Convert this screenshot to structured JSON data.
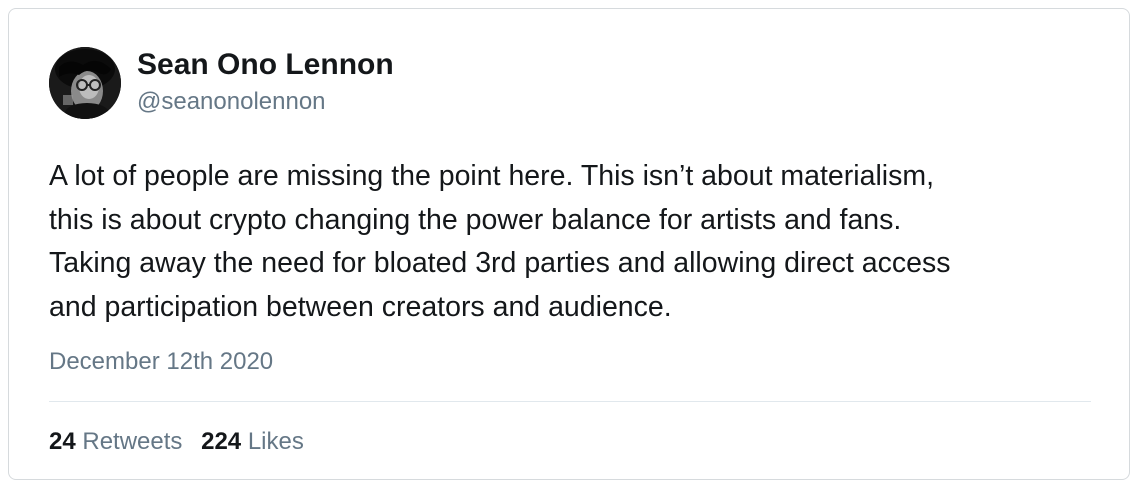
{
  "tweet": {
    "author": {
      "name": "Sean Ono Lennon",
      "handle": "@seanonolennon",
      "avatar": "profile-photo"
    },
    "text_lines": [
      "A lot of people are missing the point here. This isn’t about materialism,",
      "this is about crypto changing the power balance for artists and fans.",
      "Taking away the need for bloated 3rd parties and allowing direct access",
      "and participation between creators and audience."
    ],
    "date": "December 12th 2020",
    "stats": {
      "retweets_count": "24",
      "retweets_label": "Retweets",
      "likes_count": "224",
      "likes_label": "Likes"
    }
  },
  "colors": {
    "text": "#14171a",
    "secondary_text": "#657786",
    "border": "#d6dadd",
    "divider": "#e1e8ed"
  }
}
